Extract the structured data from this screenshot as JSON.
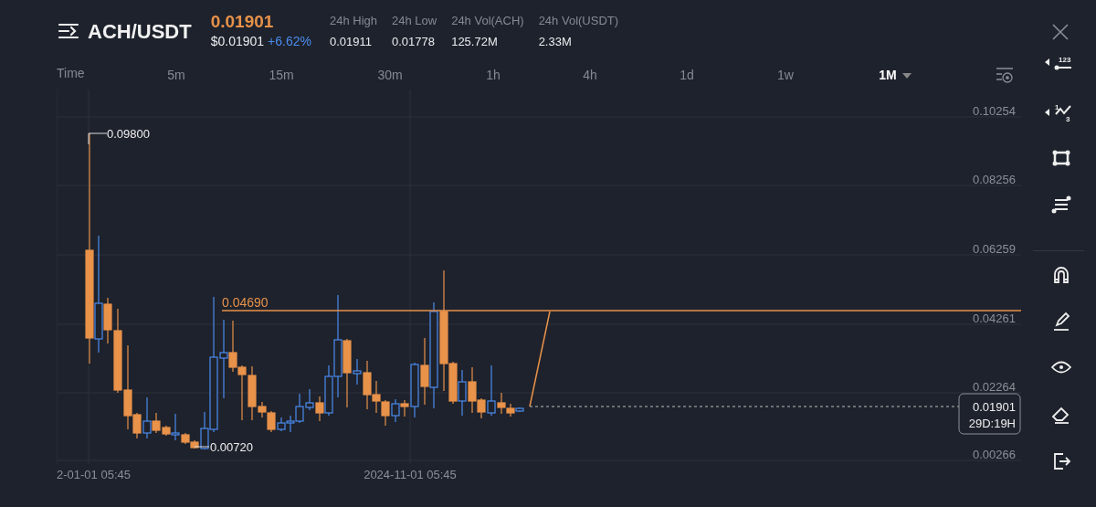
{
  "header": {
    "pair": "ACH/USDT",
    "price": "0.01901",
    "usd_price": "$0.01901",
    "change": "+6.62%",
    "stats": [
      {
        "label": "24h High",
        "value": "0.01911"
      },
      {
        "label": "24h Low",
        "value": "0.01778"
      },
      {
        "label": "24h Vol(ACH)",
        "value": "125.72M"
      },
      {
        "label": "24h Vol(USDT)",
        "value": "2.33M"
      }
    ]
  },
  "time_label": "Time",
  "intervals": [
    {
      "label": "5m",
      "selected": false
    },
    {
      "label": "15m",
      "selected": false
    },
    {
      "label": "30m",
      "selected": false
    },
    {
      "label": "1h",
      "selected": false
    },
    {
      "label": "4h",
      "selected": false
    },
    {
      "label": "1d",
      "selected": false
    },
    {
      "label": "1w",
      "selected": false
    },
    {
      "label": "1M",
      "selected": true
    }
  ],
  "toolbar_texts": [
    "123",
    "1",
    "3"
  ],
  "chart": {
    "y_axis_labels": [
      "0.10254",
      "0.08256",
      "0.06259",
      "0.04261",
      "0.02264",
      "0.00266"
    ],
    "x_axis_labels": [
      "2-01-01 05:45",
      "2024-11-01 05:45"
    ],
    "high_marker": "0.09800",
    "low_marker": "0.00720",
    "line_label": "0.04690",
    "last_price": "0.01901",
    "countdown": "29D:19H"
  }
}
